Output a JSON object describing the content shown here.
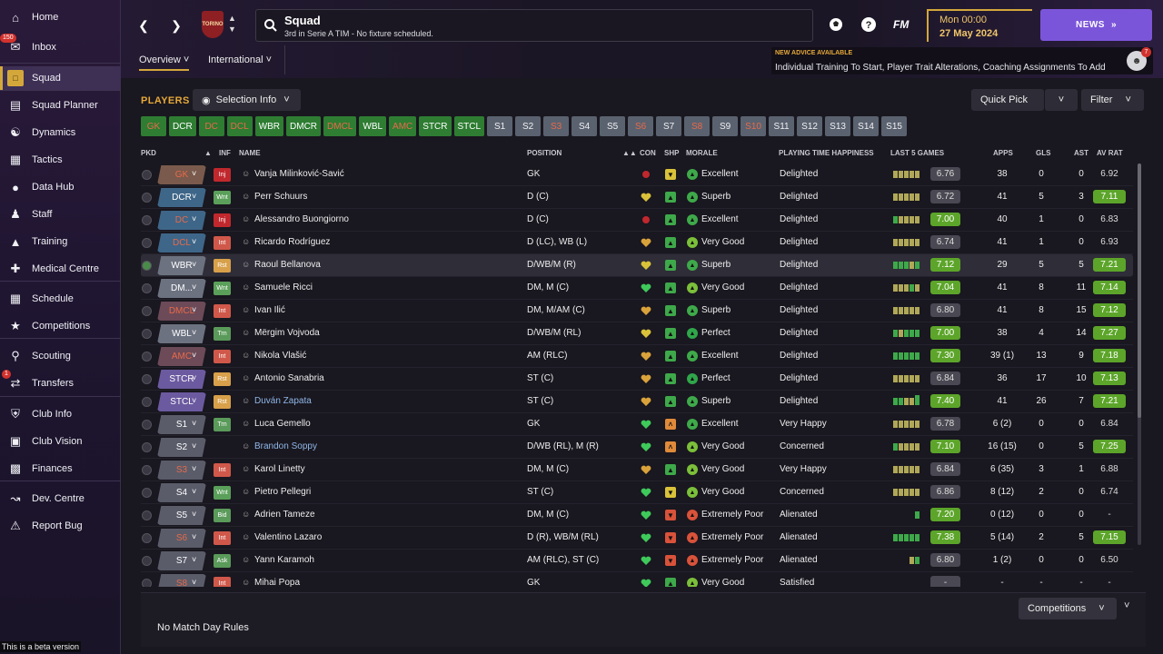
{
  "sidebar": {
    "items": [
      {
        "label": "Home",
        "icon": "home-icon"
      },
      {
        "label": "Inbox",
        "icon": "inbox-icon",
        "badge": "150"
      },
      {
        "label": "Squad",
        "icon": "shirt-icon",
        "active": true
      },
      {
        "label": "Squad Planner",
        "icon": "clipboard-icon"
      },
      {
        "label": "Dynamics",
        "icon": "dynamics-icon"
      },
      {
        "label": "Tactics",
        "icon": "tactics-icon"
      },
      {
        "label": "Data Hub",
        "icon": "data-hub-icon"
      },
      {
        "label": "Staff",
        "icon": "staff-icon"
      },
      {
        "label": "Training",
        "icon": "training-icon"
      },
      {
        "label": "Medical Centre",
        "icon": "medical-icon"
      },
      {
        "label": "Schedule",
        "icon": "calendar-icon"
      },
      {
        "label": "Competitions",
        "icon": "trophy-icon"
      },
      {
        "label": "Scouting",
        "icon": "scouting-icon"
      },
      {
        "label": "Transfers",
        "icon": "transfers-icon",
        "badge": "1"
      },
      {
        "label": "Club Info",
        "icon": "shield-icon"
      },
      {
        "label": "Club Vision",
        "icon": "briefcase-icon"
      },
      {
        "label": "Finances",
        "icon": "finances-icon"
      },
      {
        "label": "Dev. Centre",
        "icon": "dev-centre-icon"
      },
      {
        "label": "Report Bug",
        "icon": "report-bug-icon"
      }
    ],
    "beta": "This is a beta version"
  },
  "header": {
    "title": "Squad",
    "subtitle": "3rd in Serie A TIM - No fixture scheduled.",
    "fm": "FM",
    "date_line1": "Mon 00:00",
    "date_line2": "27 May 2024",
    "news": "NEWS",
    "crest": "TORINO",
    "tabs": [
      "Overview",
      "International"
    ],
    "advice_title": "NEW ADVICE AVAILABLE",
    "advice_text": "Individual Training To Start, Player Trait Alterations, Coaching Assignments To Add",
    "advice_badge": "7"
  },
  "main": {
    "players_title": "PLAYERS",
    "selection_info": "Selection Info",
    "quick_pick": "Quick Pick",
    "filter": "Filter",
    "positions": [
      {
        "l": "GK",
        "c": "gr"
      },
      {
        "l": "DCR",
        "c": "g"
      },
      {
        "l": "DC",
        "c": "gr"
      },
      {
        "l": "DCL",
        "c": "gr"
      },
      {
        "l": "WBR",
        "c": "g"
      },
      {
        "l": "DMCR",
        "c": "g"
      },
      {
        "l": "DMCL",
        "c": "gr"
      },
      {
        "l": "WBL",
        "c": "g"
      },
      {
        "l": "AMC",
        "c": "gr"
      },
      {
        "l": "STCR",
        "c": "g"
      },
      {
        "l": "STCL",
        "c": "g"
      },
      {
        "l": "S1",
        "c": "s"
      },
      {
        "l": "S2",
        "c": "s"
      },
      {
        "l": "S3",
        "c": "sr"
      },
      {
        "l": "S4",
        "c": "s"
      },
      {
        "l": "S5",
        "c": "s"
      },
      {
        "l": "S6",
        "c": "sr"
      },
      {
        "l": "S7",
        "c": "s"
      },
      {
        "l": "S8",
        "c": "sr"
      },
      {
        "l": "S9",
        "c": "s"
      },
      {
        "l": "S10",
        "c": "sr"
      },
      {
        "l": "S11",
        "c": "s"
      },
      {
        "l": "S12",
        "c": "s"
      },
      {
        "l": "S13",
        "c": "s"
      },
      {
        "l": "S14",
        "c": "s"
      },
      {
        "l": "S15",
        "c": "s"
      }
    ],
    "columns": {
      "pkd": "PKD",
      "inf": "INF",
      "name": "NAME",
      "position": "POSITION",
      "con": "CON",
      "shp": "SHP",
      "morale": "MORALE",
      "pth": "PLAYING TIME HAPPINESS",
      "last5": "LAST 5 GAMES",
      "apps": "APPS",
      "gls": "GLS",
      "ast": "AST",
      "avrat": "AV RAT"
    },
    "rows": [
      {
        "pk": "GK",
        "pkc": "gk",
        "inf": "Inj",
        "infc": "inj",
        "name": "Vanja Milinković-Savić",
        "pos": "GK",
        "con": "red",
        "shp": "y",
        "mor": "Excellent",
        "pth": "Delighted",
        "bars": "yyyyy",
        "l5": "6.76",
        "l5c": "n",
        "apps": "38",
        "gls": "0",
        "ast": "0",
        "av": "6.92",
        "avc": "n"
      },
      {
        "pk": "DCR",
        "pkc": "blue",
        "inf": "Wnt",
        "infc": "wnt",
        "name": "Perr Schuurs",
        "pos": "D (C)",
        "con": "heart-y",
        "shp": "g",
        "mor": "Superb",
        "pth": "Delighted",
        "bars": "yyyyy",
        "l5": "6.72",
        "l5c": "n",
        "apps": "41",
        "gls": "5",
        "ast": "3",
        "av": "7.11",
        "avc": "g"
      },
      {
        "pk": "DC",
        "pkc": "blue red",
        "inf": "Inj",
        "infc": "inj",
        "name": "Alessandro Buongiorno",
        "pos": "D (C)",
        "con": "red",
        "shp": "g",
        "mor": "Excellent",
        "pth": "Delighted",
        "bars": "gyyyy",
        "l5": "7.00",
        "l5c": "g",
        "apps": "40",
        "gls": "1",
        "ast": "0",
        "av": "6.83",
        "avc": "n"
      },
      {
        "pk": "DCL",
        "pkc": "blue red",
        "inf": "Int",
        "infc": "int",
        "name": "Ricardo Rodríguez",
        "pos": "D (LC), WB (L)",
        "con": "heart-o",
        "shp": "g",
        "mor": "Very Good",
        "pth": "Delighted",
        "bars": "yyyyy",
        "l5": "6.74",
        "l5c": "n",
        "apps": "41",
        "gls": "1",
        "ast": "0",
        "av": "6.93",
        "avc": "n"
      },
      {
        "pk": "WBR",
        "pkc": "grey",
        "inf": "Rst",
        "infc": "rst",
        "name": "Raoul Bellanova",
        "pos": "D/WB/M (R)",
        "con": "heart-y",
        "shp": "g",
        "mor": "Superb",
        "pth": "Delighted",
        "bars": "gggyg",
        "l5": "7.12",
        "l5c": "g",
        "apps": "29",
        "gls": "5",
        "ast": "5",
        "av": "7.21",
        "avc": "g",
        "hl": true
      },
      {
        "pk": "DM...",
        "pkc": "grey",
        "inf": "Wnt",
        "infc": "wnt",
        "name": "Samuele Ricci",
        "pos": "DM, M (C)",
        "con": "heart-g",
        "shp": "g",
        "mor": "Very Good",
        "pth": "Delighted",
        "bars": "yyygy",
        "l5": "7.04",
        "l5c": "g",
        "apps": "41",
        "gls": "8",
        "ast": "11",
        "av": "7.14",
        "avc": "g"
      },
      {
        "pk": "DMCL",
        "pkc": "dred",
        "inf": "Int",
        "infc": "int",
        "name": "Ivan Ilić",
        "pos": "DM, M/AM (C)",
        "con": "heart-o",
        "shp": "g",
        "mor": "Superb",
        "pth": "Delighted",
        "bars": "yyyyy",
        "l5": "6.80",
        "l5c": "n",
        "apps": "41",
        "gls": "8",
        "ast": "15",
        "av": "7.12",
        "avc": "g"
      },
      {
        "pk": "WBL",
        "pkc": "grey",
        "inf": "Trn",
        "infc": "trn",
        "name": "Mërgim Vojvoda",
        "pos": "D/WB/M (RL)",
        "con": "heart-y",
        "shp": "g",
        "mor": "Perfect",
        "pth": "Delighted",
        "bars": "gyggg",
        "l5": "7.00",
        "l5c": "g",
        "apps": "38",
        "gls": "4",
        "ast": "14",
        "av": "7.27",
        "avc": "g"
      },
      {
        "pk": "AMC",
        "pkc": "dred",
        "inf": "Int",
        "infc": "int",
        "name": "Nikola Vlašić",
        "pos": "AM (RLC)",
        "con": "heart-o",
        "shp": "g",
        "mor": "Excellent",
        "pth": "Delighted",
        "bars": "ggggg",
        "l5": "7.30",
        "l5c": "g",
        "apps": "39 (1)",
        "gls": "13",
        "ast": "9",
        "av": "7.18",
        "avc": "g"
      },
      {
        "pk": "STCR",
        "pkc": "purple",
        "inf": "Rst",
        "infc": "rst",
        "name": "Antonio Sanabria",
        "pos": "ST (C)",
        "con": "heart-o",
        "shp": "g",
        "mor": "Perfect",
        "pth": "Delighted",
        "bars": "yyyyy",
        "l5": "6.84",
        "l5c": "n",
        "apps": "36",
        "gls": "17",
        "ast": "10",
        "av": "7.13",
        "avc": "g"
      },
      {
        "pk": "STCL",
        "pkc": "purple",
        "inf": "Rst",
        "infc": "rst",
        "name": "Duván Zapata",
        "link": true,
        "pos": "ST (C)",
        "con": "heart-o",
        "shp": "g",
        "mor": "Superb",
        "pth": "Delighted",
        "bars": "ggyyh",
        "l5": "7.40",
        "l5c": "g",
        "apps": "41",
        "gls": "26",
        "ast": "7",
        "av": "7.21",
        "avc": "g"
      },
      {
        "pk": "S1",
        "pkc": "slate",
        "inf": "Trn",
        "infc": "trn",
        "name": "Luca Gemello",
        "pos": "GK",
        "con": "heart-g",
        "shp": "o",
        "mor": "Excellent",
        "pth": "Very Happy",
        "bars": "yyyyy",
        "l5": "6.78",
        "l5c": "n",
        "apps": "6 (2)",
        "gls": "0",
        "ast": "0",
        "av": "6.84",
        "avc": "n"
      },
      {
        "pk": "S2",
        "pkc": "slate",
        "inf": "",
        "infc": "",
        "name": "Brandon Soppy",
        "link": true,
        "pos": "D/WB (RL), M (R)",
        "con": "heart-g",
        "shp": "o",
        "mor": "Very Good",
        "pth": "Concerned",
        "bars": "gyyyy",
        "l5": "7.10",
        "l5c": "g",
        "apps": "16 (15)",
        "gls": "0",
        "ast": "5",
        "av": "7.25",
        "avc": "g"
      },
      {
        "pk": "S3",
        "pkc": "slate red",
        "inf": "Int",
        "infc": "int",
        "name": "Karol Linetty",
        "pos": "DM, M (C)",
        "con": "heart-o",
        "shp": "g",
        "mor": "Very Good",
        "pth": "Very Happy",
        "bars": "yyyyy",
        "l5": "6.84",
        "l5c": "n",
        "apps": "6 (35)",
        "gls": "3",
        "ast": "1",
        "av": "6.88",
        "avc": "n"
      },
      {
        "pk": "S4",
        "pkc": "slate",
        "inf": "Wnt",
        "infc": "wnt",
        "name": "Pietro Pellegri",
        "pos": "ST (C)",
        "con": "heart-g",
        "shp": "y",
        "mor": "Very Good",
        "pth": "Concerned",
        "bars": "yyyyy",
        "l5": "6.86",
        "l5c": "n",
        "apps": "8 (12)",
        "gls": "2",
        "ast": "0",
        "av": "6.74",
        "avc": "n"
      },
      {
        "pk": "S5",
        "pkc": "slate",
        "inf": "Bid",
        "infc": "bid",
        "name": "Adrien Tameze",
        "pos": "DM, M (C)",
        "con": "heart-g",
        "shp": "r",
        "mor": "Extremely Poor",
        "pth": "Alienated",
        "bars": "g",
        "l5": "7.20",
        "l5c": "g",
        "apps": "0 (12)",
        "gls": "0",
        "ast": "0",
        "av": "-",
        "avc": "n"
      },
      {
        "pk": "S6",
        "pkc": "slate red",
        "inf": "Int",
        "infc": "int",
        "name": "Valentino Lazaro",
        "pos": "D (R), WB/M (RL)",
        "con": "heart-g",
        "shp": "r",
        "mor": "Extremely Poor",
        "pth": "Alienated",
        "bars": "ggggg",
        "l5": "7.38",
        "l5c": "g",
        "apps": "5 (14)",
        "gls": "2",
        "ast": "5",
        "av": "7.15",
        "avc": "g"
      },
      {
        "pk": "S7",
        "pkc": "slate",
        "inf": "Ask",
        "infc": "ask",
        "name": "Yann Karamoh",
        "pos": "AM (RLC), ST (C)",
        "con": "heart-g",
        "shp": "r",
        "mor": "Extremely Poor",
        "pth": "Alienated",
        "bars": "yg",
        "l5": "6.80",
        "l5c": "n",
        "apps": "1 (2)",
        "gls": "0",
        "ast": "0",
        "av": "6.50",
        "avc": "n"
      },
      {
        "pk": "S8",
        "pkc": "slate red",
        "inf": "Int",
        "infc": "int",
        "name": "Mihai Popa",
        "pos": "GK",
        "con": "heart-g",
        "shp": "g",
        "mor": "Very Good",
        "pth": "Satisfied",
        "bars": "",
        "l5": "-",
        "l5c": "n",
        "apps": "-",
        "gls": "-",
        "ast": "-",
        "av": "-",
        "avc": "n"
      }
    ],
    "competitions_btn": "Competitions",
    "no_rules": "No Match Day Rules"
  }
}
